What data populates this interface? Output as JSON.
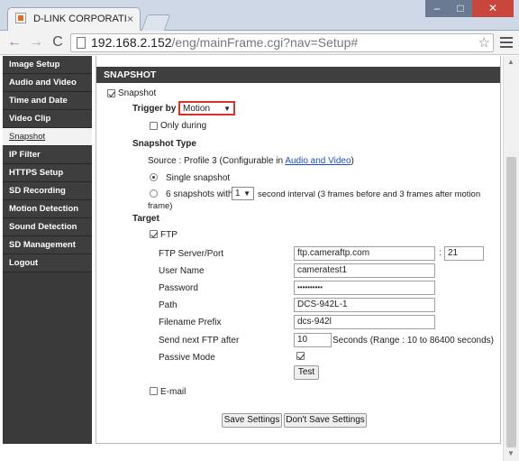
{
  "browser": {
    "tab_title": "D-LINK CORPORATION | W",
    "tab_close": "×",
    "url_host": "192.168.2.152",
    "url_path": "/eng/mainFrame.cgi?nav=Setup#",
    "back_glyph": "←",
    "forward_glyph": "→",
    "reload_glyph": "C",
    "star_glyph": "☆",
    "min_glyph": "–",
    "max_glyph": "□",
    "close_glyph": "✕"
  },
  "sidebar": {
    "items": [
      {
        "label": "Image Setup"
      },
      {
        "label": "Audio and Video"
      },
      {
        "label": "Time and Date"
      },
      {
        "label": "Video Clip"
      },
      {
        "label": "Snapshot"
      },
      {
        "label": "IP Filter"
      },
      {
        "label": "HTTPS Setup"
      },
      {
        "label": "SD Recording"
      },
      {
        "label": "Motion Detection"
      },
      {
        "label": "Sound Detection"
      },
      {
        "label": "SD Management"
      },
      {
        "label": "Logout"
      }
    ],
    "active_index": 4
  },
  "section": {
    "title": "SNAPSHOT",
    "snapshot_label": "Snapshot",
    "trigger_label": "Trigger by",
    "trigger_value": "Motion",
    "only_during_label": "Only during",
    "snapshot_type_label": "Snapshot Type",
    "source_prefix": "Source : Profile 3 (Configurable in ",
    "source_link": "Audio and Video",
    "source_suffix": ")",
    "single_snapshot_label": "Single snapshot",
    "six_snapshots_prefix": "6 snapshots with",
    "interval_value": "1",
    "interval_suffix": "second interval (3 frames before and 3 frames after motion",
    "interval_suffix2": "frame)",
    "target_label": "Target",
    "ftp_label": "FTP",
    "ftp_server_label": "FTP Server/Port",
    "ftp_server_value": "ftp.cameraftp.com",
    "port_sep": ":",
    "ftp_port_value": "21",
    "username_label": "User Name",
    "username_value": "cameratest1",
    "password_label": "Password",
    "password_value": "••••••••••",
    "path_label": "Path",
    "path_value": "DCS-942L-1",
    "prefix_label": "Filename Prefix",
    "prefix_value": "dcs-942l",
    "send_next_label": "Send next FTP after",
    "send_next_value": "10",
    "seconds_text": "Seconds  (Range : 10 to 86400 seconds)",
    "passive_label": "Passive Mode",
    "test_button": "Test",
    "email_label": "E-mail"
  },
  "footer": {
    "save_button": "Save Settings",
    "dont_save_button": "Don't Save Settings"
  },
  "state": {
    "snapshot_checked": true,
    "only_during_checked": false,
    "single_snapshot_selected": true,
    "ftp_checked": true,
    "passive_checked": true,
    "email_checked": false
  },
  "colors": {
    "sidebar_bg": "#3a3a3a",
    "section_bar_bg": "#3f3f3f",
    "trigger_highlight": "#d8332b",
    "link": "#1a4ec4",
    "window_close": "#c9463d"
  }
}
